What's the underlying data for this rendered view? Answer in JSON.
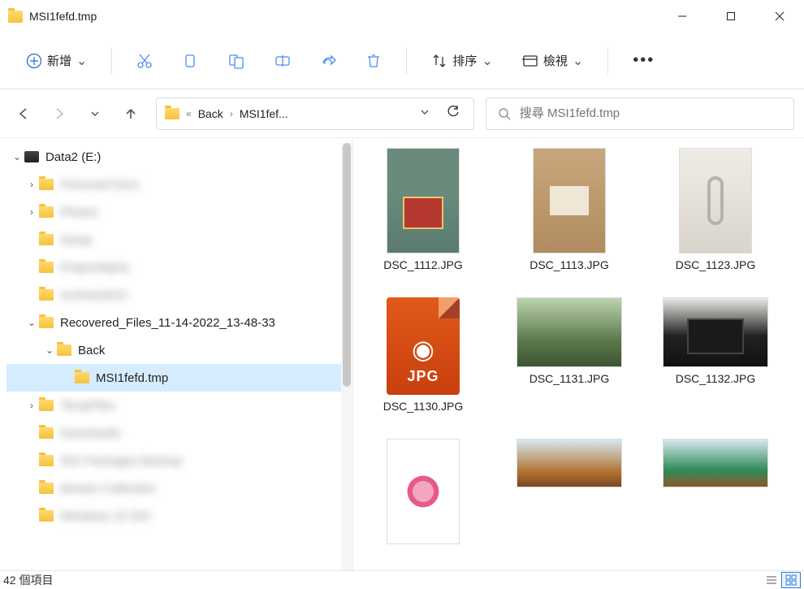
{
  "window": {
    "title": "MSI1fefd.tmp"
  },
  "toolbar": {
    "new_label": "新增",
    "sort_label": "排序",
    "view_label": "檢視"
  },
  "breadcrumb": {
    "seg1": "Back",
    "seg2": "MSI1fef..."
  },
  "search": {
    "placeholder": "搜尋 MSI1fefd.tmp"
  },
  "tree": {
    "drive": "Data2 (E:)",
    "recovered": "Recovered_Files_11-14-2022_13-48-33",
    "back": "Back",
    "current": "MSI1fefd.tmp",
    "blur1": "Personal Docs",
    "blur2": "Photos",
    "blur3": "Setup",
    "blur4": "ProjectAlpha",
    "blur5": "Archive2021",
    "blur6": "TempFiles",
    "blur7": "Downloads",
    "blur8": "ISO Packages Backup",
    "blur9": "Movies Collection",
    "blur10": "Windows 10 ISO"
  },
  "files": {
    "f1": "DSC_1112.JPG",
    "f2": "DSC_1113.JPG",
    "f3": "DSC_1123.JPG",
    "f4": "DSC_1130.JPG",
    "f5": "DSC_1131.JPG",
    "f6": "DSC_1132.JPG",
    "jpg_label": "JPG"
  },
  "status": {
    "items": "42 個項目"
  }
}
